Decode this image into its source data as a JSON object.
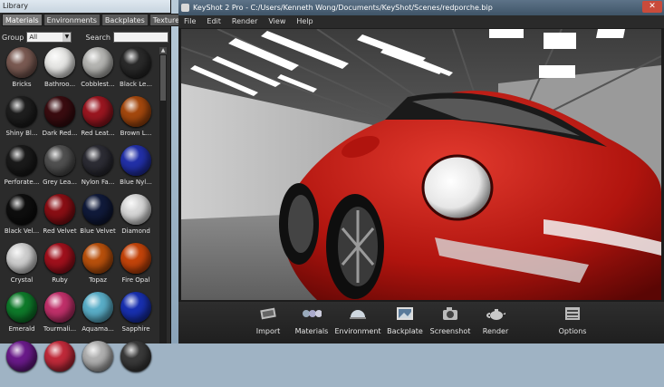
{
  "library": {
    "title": "Library",
    "tabs": [
      "Materials",
      "Environments",
      "Backplates",
      "Textures",
      "◄"
    ],
    "group_label": "Group",
    "group_value": "All",
    "search_label": "Search",
    "materials": [
      {
        "label": "Bricks",
        "color": "#7a5a52"
      },
      {
        "label": "Bathroo...",
        "color": "#e8e8e6"
      },
      {
        "label": "Cobblest...",
        "color": "#b5b5b2"
      },
      {
        "label": "Black Le...",
        "color": "#2a2a2a"
      },
      {
        "label": "Shiny Bl...",
        "color": "#1e1e1e"
      },
      {
        "label": "Dark Red...",
        "color": "#3a0c10"
      },
      {
        "label": "Red Leat...",
        "color": "#9a1620"
      },
      {
        "label": "Brown L...",
        "color": "#a4480e"
      },
      {
        "label": "Perforate...",
        "color": "#1a1a1a"
      },
      {
        "label": "Grey Lea...",
        "color": "#505050"
      },
      {
        "label": "Nylon Fa...",
        "color": "#2c2c34"
      },
      {
        "label": "Blue Nyl...",
        "color": "#2230a8"
      },
      {
        "label": "Black Vel...",
        "color": "#0e0e0e"
      },
      {
        "label": "Red Velvet",
        "color": "#8a0e14"
      },
      {
        "label": "Blue Velvet",
        "color": "#101a3a"
      },
      {
        "label": "Diamond",
        "color": "#d8d8d8"
      },
      {
        "label": "Crystal",
        "color": "#cfcfcf"
      },
      {
        "label": "Ruby",
        "color": "#a0101c"
      },
      {
        "label": "Topaz",
        "color": "#b8500c"
      },
      {
        "label": "Fire Opal",
        "color": "#c4440a"
      },
      {
        "label": "Emerald",
        "color": "#0e7a2a"
      },
      {
        "label": "Tourmali...",
        "color": "#c0306a"
      },
      {
        "label": "Aquama...",
        "color": "#5aaec8"
      },
      {
        "label": "Sapphire",
        "color": "#1830b0"
      },
      {
        "label": "",
        "color": "#6a1a8a"
      },
      {
        "label": "",
        "color": "#c02a3a"
      },
      {
        "label": "",
        "color": "#b0b0b0"
      },
      {
        "label": "",
        "color": "#3a3a3a"
      }
    ]
  },
  "keyshot": {
    "title": "KeyShot 2 Pro  -  C:/Users/Kenneth Wong/Documents/KeyShot/Scenes/redporche.bip",
    "close_label": "✕",
    "menu": [
      "File",
      "Edit",
      "Render",
      "View",
      "Help"
    ],
    "toolbar": [
      {
        "label": "Import",
        "icon": "import-icon"
      },
      {
        "label": "Materials",
        "icon": "materials-icon"
      },
      {
        "label": "Environment",
        "icon": "environment-icon"
      },
      {
        "label": "Backplate",
        "icon": "backplate-icon"
      },
      {
        "label": "Screenshot",
        "icon": "camera-icon"
      },
      {
        "label": "Render",
        "icon": "teapot-icon"
      },
      {
        "label": "Options",
        "icon": "options-icon"
      }
    ]
  }
}
